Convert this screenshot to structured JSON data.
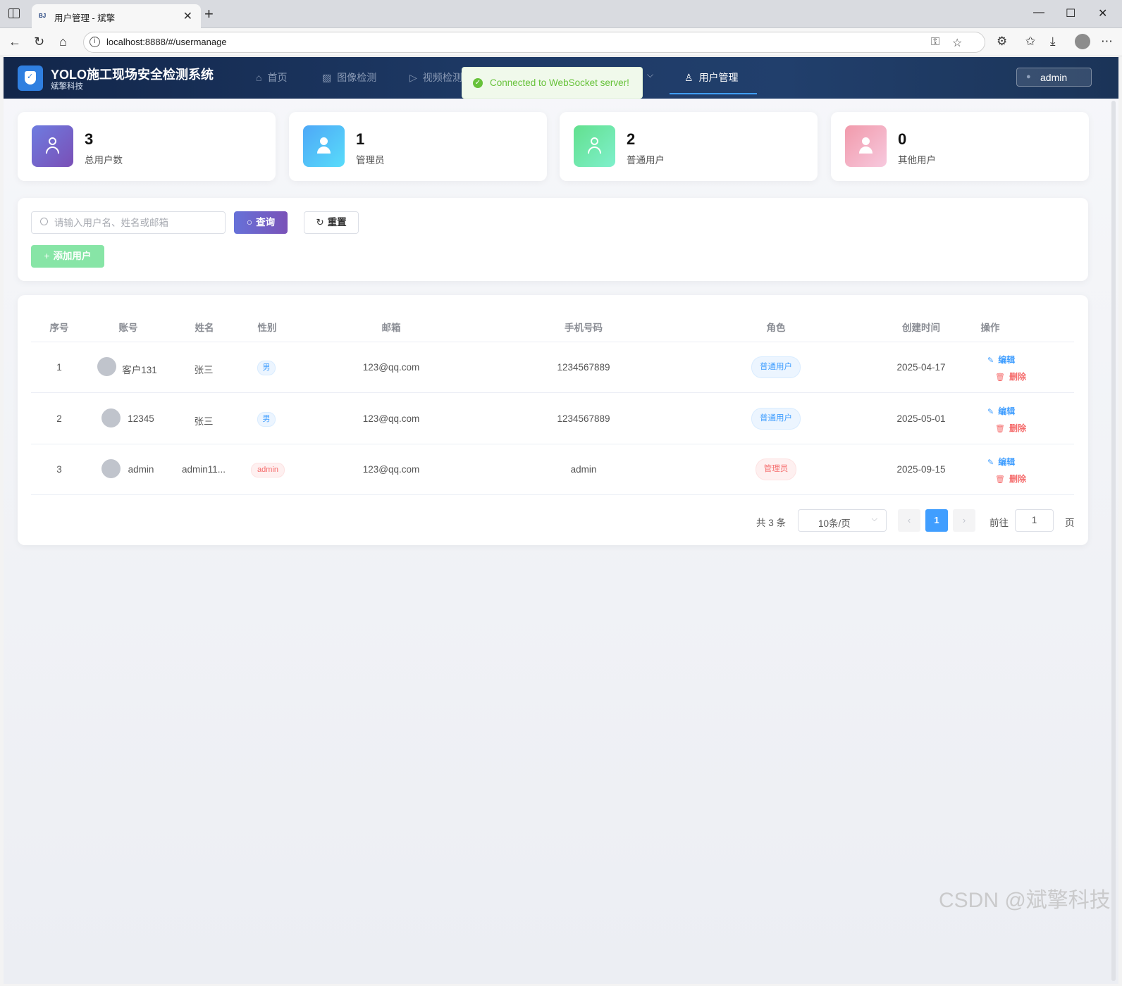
{
  "browser": {
    "tab_favicon": "BJ",
    "tab_title": "用户管理 - 斌擎",
    "url": "localhost:8888/#/usermanage"
  },
  "header": {
    "title": "YOLO施工现场安全检测系统",
    "subtitle": "斌擎科技",
    "menu": [
      {
        "label": "首页",
        "icon": "home-icon"
      },
      {
        "label": "图像检测",
        "icon": "image-icon"
      },
      {
        "label": "视频检测",
        "icon": "play-icon"
      },
      {
        "label": "用户管理",
        "icon": "user-icon",
        "active": true
      }
    ],
    "user": "admin"
  },
  "toast": {
    "message": "Connected to WebSocket server!"
  },
  "stats": [
    {
      "value": "3",
      "label": "总用户数",
      "color": "#6a5fc4"
    },
    {
      "value": "1",
      "label": "管理员",
      "color": "#4fa8f5"
    },
    {
      "value": "2",
      "label": "普通用户",
      "color": "#6fe3a6"
    },
    {
      "value": "0",
      "label": "其他用户",
      "color": "#f2a3b5"
    }
  ],
  "search": {
    "placeholder": "请输入用户名、姓名或邮箱",
    "query_label": "查询",
    "reset_label": "重置",
    "add_label": "添加用户"
  },
  "table": {
    "headers": [
      "序号",
      "账号",
      "姓名",
      "性别",
      "邮箱",
      "手机号码",
      "角色",
      "创建时间",
      "操作"
    ],
    "rows": [
      {
        "index": "1",
        "account": "客户131",
        "name": "张三",
        "gender": "男",
        "email": "123@qq.com",
        "phone": "1234567889",
        "role": "普通用户",
        "created": "2025-04-17"
      },
      {
        "index": "2",
        "account": "12345",
        "name": "张三",
        "gender": "男",
        "email": "123@qq.com",
        "phone": "1234567889",
        "role": "普通用户",
        "created": "2025-05-01"
      },
      {
        "index": "3",
        "account": "admin",
        "name": "admin11...",
        "gender": "admin",
        "email": "123@qq.com",
        "phone": "admin",
        "role": "管理员",
        "created": "2025-09-15"
      }
    ],
    "edit_label": "编辑",
    "delete_label": "删除"
  },
  "pagination": {
    "total": "共 3 条",
    "page_size": "10条/页",
    "current": "1",
    "goto_label": "前往",
    "goto_value": "1",
    "page_suffix": "页"
  },
  "watermark": "CSDN @斌擎科技"
}
